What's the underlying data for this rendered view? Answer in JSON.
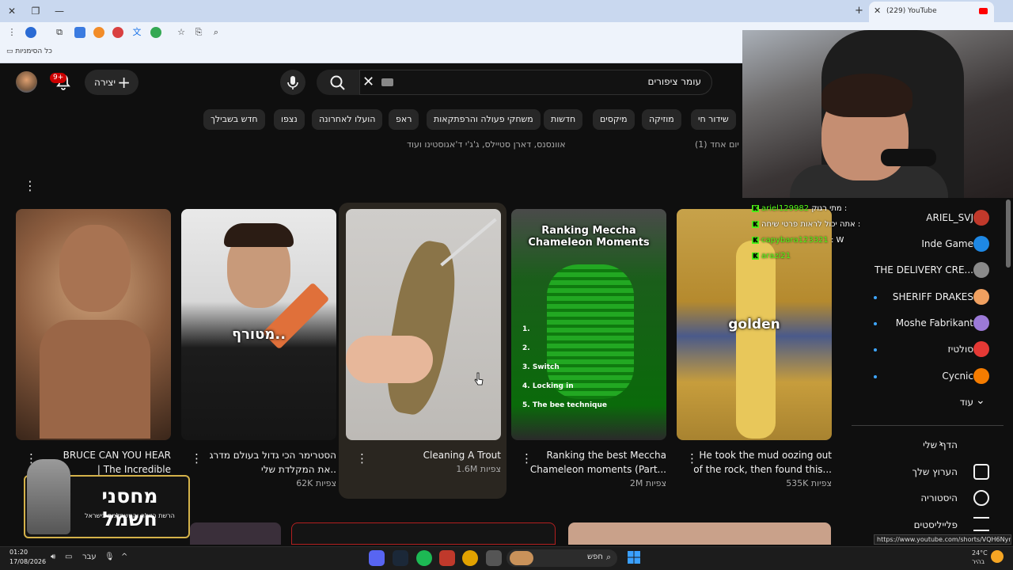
{
  "browser": {
    "tab_title": "(229) YouTube",
    "bookmarks_label": "כל הסימניות",
    "status_url": "https://www.youtube.com/shorts/VQH6Nyrqf3s"
  },
  "header": {
    "notif_count": "9+",
    "create_label": "יצירה",
    "search_value": "עומר ציפורים"
  },
  "chips": [
    "שידור חי",
    "מוזיקה",
    "מיקסים",
    "חדשות",
    "משחקי פעולה והרפתקאות",
    "ראפ",
    "הועלו לאחרונה",
    "נצפו",
    "חדש בשבילך"
  ],
  "row_meta": {
    "channels": "אוונסנס, דארן סטיילס, ג'ג'י ד'אגוסטינו ועוד",
    "oneday": "י יום אחד (1)"
  },
  "shorts": [
    {
      "title_1": "BRUCE CAN YOU HEAR",
      "title_2": "| The Incredible",
      "views": "",
      "overlay": ""
    },
    {
      "title_1": "הסטרימר הכי גדול בעולם מדרג",
      "title_2": "את המקלדת שלי..",
      "views": "62K צפיות",
      "overlay": "מטורף.."
    },
    {
      "title_1": "Cleaning A Trout",
      "title_2": "",
      "views": "1.6M צפיות",
      "overlay": ""
    },
    {
      "title_1": "Ranking the best Meccha",
      "title_2": "Chameleon moments (Part...",
      "views": "2M צפיות",
      "overlay": "Ranking Meccha Chameleon Moments"
    },
    {
      "title_1": "He took the mud oozing out",
      "title_2": "of the rock, then found this...",
      "views": "535K צפיות",
      "overlay": "golden"
    }
  ],
  "short4_list": [
    "1.",
    "2.",
    "3. Switch",
    "4. Locking in",
    "5. The bee technique"
  ],
  "chat": [
    {
      "user": "ariel129982",
      "msg": "מתי רגוק :"
    },
    {
      "user": "",
      "msg": "אתה יכול לראות פרטי שיחה :"
    },
    {
      "user": "capybara123321",
      "msg": ": W"
    },
    {
      "user": "arazi21",
      "msg": ""
    }
  ],
  "subscriptions": [
    {
      "name": "ARIEL_SVJ",
      "dot": false,
      "color": "#c0392b"
    },
    {
      "name": "Inde Game",
      "dot": false,
      "color": "#1e88e5"
    },
    {
      "name": "THE DELIVERY CRE...",
      "dot": false,
      "color": "#8a8a8a"
    },
    {
      "name": "SHERIFF DRAKES",
      "dot": true,
      "color": "#f0a060"
    },
    {
      "name": "Moshe Fabrikant",
      "dot": true,
      "color": "#9c7ad8"
    },
    {
      "name": "סולטיז",
      "dot": true,
      "color": "#e53935"
    },
    {
      "name": "Cycnic",
      "dot": true,
      "color": "#f57c00"
    },
    {
      "name": "עוד",
      "dot": false,
      "color": ""
    }
  ],
  "you_section": {
    "heading": "הדף שלי",
    "links": [
      "הערוץ שלך",
      "היסטוריה",
      "פלייליסטים"
    ]
  },
  "sponsor": {
    "title": "מחסני חשמל",
    "subtitle": "הרשת הזולה והמשתלמת בישראל"
  },
  "taskbar": {
    "time": "01:20",
    "date": "17/08/2026",
    "lang": "עבר",
    "search": "חפש",
    "temp": "24°C",
    "weather": "בהיר"
  }
}
